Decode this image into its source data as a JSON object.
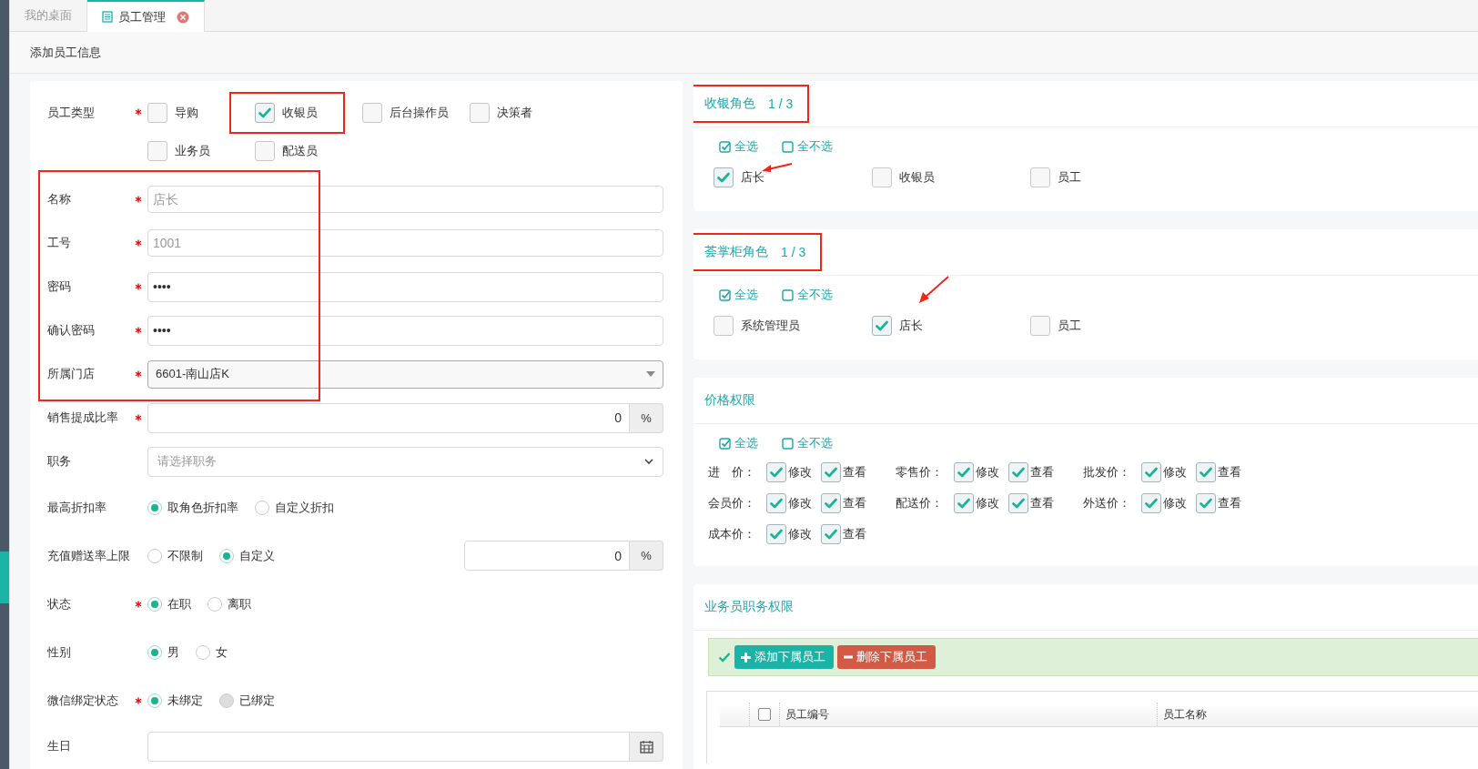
{
  "tabs": [
    {
      "label": "我的桌面",
      "selected": false,
      "closable": false
    },
    {
      "label": "员工管理",
      "selected": true,
      "closable": true
    }
  ],
  "page_title": "添加员工信息",
  "employee_type": {
    "label": "员工类型",
    "required": true,
    "options": [
      {
        "label": "导购",
        "checked": false,
        "highlighted": false
      },
      {
        "label": "收银员",
        "checked": true,
        "highlighted": true
      },
      {
        "label": "后台操作员",
        "checked": false,
        "highlighted": false
      },
      {
        "label": "决策者",
        "checked": false,
        "highlighted": false
      },
      {
        "label": "业务员",
        "checked": false,
        "highlighted": false
      },
      {
        "label": "配送员",
        "checked": false,
        "highlighted": false
      }
    ]
  },
  "fields": [
    {
      "kind": "text",
      "label": "名称",
      "required": true,
      "placeholder": "店长",
      "framed": true
    },
    {
      "kind": "text",
      "label": "工号",
      "required": true,
      "placeholder": "1001",
      "framed": true
    },
    {
      "kind": "password",
      "label": "密码",
      "required": true,
      "value": "••••",
      "framed": true
    },
    {
      "kind": "password",
      "label": "确认密码",
      "required": true,
      "value": "••••",
      "framed": true
    },
    {
      "kind": "select",
      "label": "所属门店",
      "required": true,
      "value": "6601-南山店K",
      "framed": true
    },
    {
      "kind": "unit",
      "label": "销售提成比率",
      "required": true,
      "value": "0",
      "unit": "%",
      "framed": false
    },
    {
      "kind": "dropdown",
      "label": "职务",
      "required": false,
      "placeholder": "请选择职务",
      "framed": false
    },
    {
      "kind": "radio",
      "label": "最高折扣率",
      "required": false,
      "framed": false,
      "options": [
        {
          "label": "取角色折扣率",
          "selected": true,
          "disabled": false
        },
        {
          "label": "自定义折扣",
          "selected": false,
          "disabled": false
        }
      ]
    },
    {
      "kind": "radio",
      "label": "充值赠送率上限",
      "required": false,
      "framed": false,
      "value": "0",
      "unit": "%",
      "options": [
        {
          "label": "不限制",
          "selected": false,
          "disabled": false
        },
        {
          "label": "自定义",
          "selected": true,
          "disabled": false
        }
      ]
    },
    {
      "kind": "radio",
      "label": "状态",
      "required": true,
      "framed": false,
      "options": [
        {
          "label": "在职",
          "selected": true,
          "disabled": false
        },
        {
          "label": "离职",
          "selected": false,
          "disabled": false
        }
      ]
    },
    {
      "kind": "radio",
      "label": "性别",
      "required": false,
      "framed": false,
      "options": [
        {
          "label": "男",
          "selected": true,
          "disabled": false
        },
        {
          "label": "女",
          "selected": false,
          "disabled": false
        }
      ]
    },
    {
      "kind": "radio",
      "label": "微信绑定状态",
      "required": true,
      "framed": false,
      "options": [
        {
          "label": "未绑定",
          "selected": true,
          "disabled": false
        },
        {
          "label": "已绑定",
          "selected": false,
          "disabled": true
        }
      ]
    },
    {
      "kind": "date",
      "label": "生日",
      "required": false,
      "framed": false
    }
  ],
  "role_panels": [
    {
      "title": "收银角色",
      "count": "1 / 3",
      "highlighted": true,
      "select_all": "全选",
      "select_none": "全不选",
      "options": [
        {
          "label": "店长",
          "checked": true,
          "arrow": true
        },
        {
          "label": "收银员",
          "checked": false,
          "arrow": false
        },
        {
          "label": "员工",
          "checked": false,
          "arrow": false
        }
      ]
    },
    {
      "title": "荟掌柜角色",
      "count": "1 / 3",
      "highlighted": true,
      "select_all": "全选",
      "select_none": "全不选",
      "options": [
        {
          "label": "系统管理员",
          "checked": false,
          "arrow": false
        },
        {
          "label": "店长",
          "checked": true,
          "arrow": true
        },
        {
          "label": "员工",
          "checked": false,
          "arrow": false
        }
      ]
    }
  ],
  "price_panel": {
    "title": "价格权限",
    "select_all": "全选",
    "select_none": "全不选",
    "items": [
      {
        "label": "进　价：",
        "perms": [
          {
            "label": "修改",
            "checked": true
          },
          {
            "label": "查看",
            "checked": true
          }
        ]
      },
      {
        "label": "零售价：",
        "perms": [
          {
            "label": "修改",
            "checked": true
          },
          {
            "label": "查看",
            "checked": true
          }
        ]
      },
      {
        "label": "批发价：",
        "perms": [
          {
            "label": "修改",
            "checked": true
          },
          {
            "label": "查看",
            "checked": true
          }
        ]
      },
      {
        "label": "会员价：",
        "perms": [
          {
            "label": "修改",
            "checked": true
          },
          {
            "label": "查看",
            "checked": true
          }
        ]
      },
      {
        "label": "配送价：",
        "perms": [
          {
            "label": "修改",
            "checked": true
          },
          {
            "label": "查看",
            "checked": true
          }
        ]
      },
      {
        "label": "外送价：",
        "perms": [
          {
            "label": "修改",
            "checked": true
          },
          {
            "label": "查看",
            "checked": true
          }
        ]
      },
      {
        "label": "成本价：",
        "perms": [
          {
            "label": "修改",
            "checked": true
          },
          {
            "label": "查看",
            "checked": true
          }
        ]
      }
    ]
  },
  "sales_panel": {
    "title": "业务员职务权限",
    "buttons": [
      {
        "label": "添加下属员工",
        "kind": "add"
      },
      {
        "label": "删除下属员工",
        "kind": "delete"
      }
    ],
    "table": {
      "select_all_checked": false,
      "columns": [
        "员工编号",
        "员工名称"
      ]
    }
  }
}
